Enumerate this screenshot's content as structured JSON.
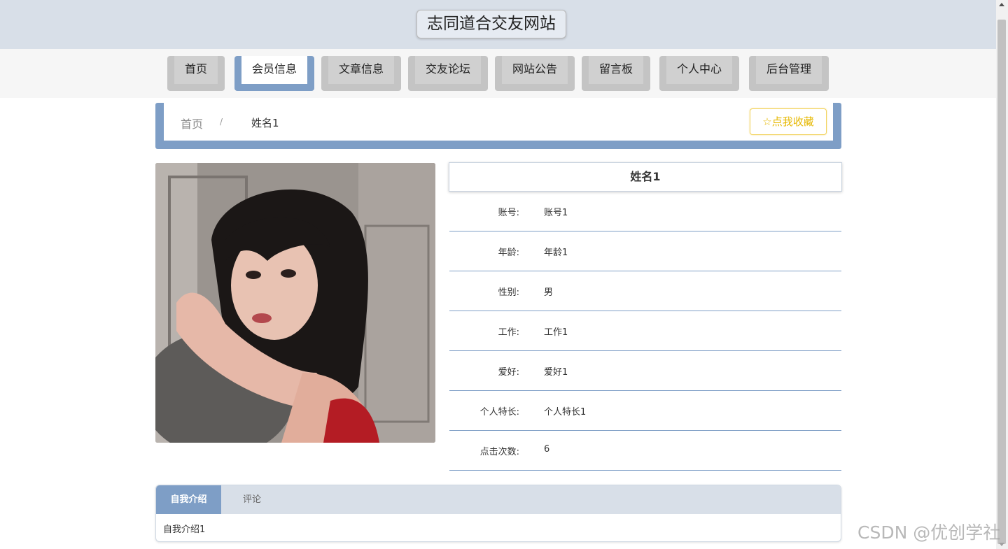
{
  "header": {
    "site_title": "志同道合交友网站"
  },
  "nav": {
    "items": [
      {
        "label": "首页"
      },
      {
        "label": "会员信息"
      },
      {
        "label": "文章信息"
      },
      {
        "label": "交友论坛"
      },
      {
        "label": "网站公告"
      },
      {
        "label": "留言板"
      },
      {
        "label": "个人中心"
      },
      {
        "label": "后台管理"
      }
    ],
    "active": "会员信息"
  },
  "breadcrumb": {
    "home": "首页",
    "separator": "/",
    "current": "姓名1"
  },
  "favorite_button": {
    "icon": "star-outline-icon",
    "label": "☆点我收藏"
  },
  "profile": {
    "name": "姓名1",
    "fields": [
      {
        "label": "账号:",
        "value": "账号1"
      },
      {
        "label": "年龄:",
        "value": "年龄1"
      },
      {
        "label": "性别:",
        "value": "男"
      },
      {
        "label": "工作:",
        "value": "工作1"
      },
      {
        "label": "爱好:",
        "value": "爱好1"
      },
      {
        "label": "个人特长:",
        "value": "个人特长1"
      },
      {
        "label": "点击次数:",
        "value": "6"
      }
    ]
  },
  "tabs": {
    "items": [
      {
        "label": "自我介绍"
      },
      {
        "label": "评论"
      }
    ],
    "active": "自我介绍",
    "content": "自我介绍1"
  },
  "watermark": "CSDN @优创学社",
  "colors": {
    "accent": "#7e9ec6",
    "header_bg": "#d8dfe8",
    "favorite": "#e6b800"
  }
}
